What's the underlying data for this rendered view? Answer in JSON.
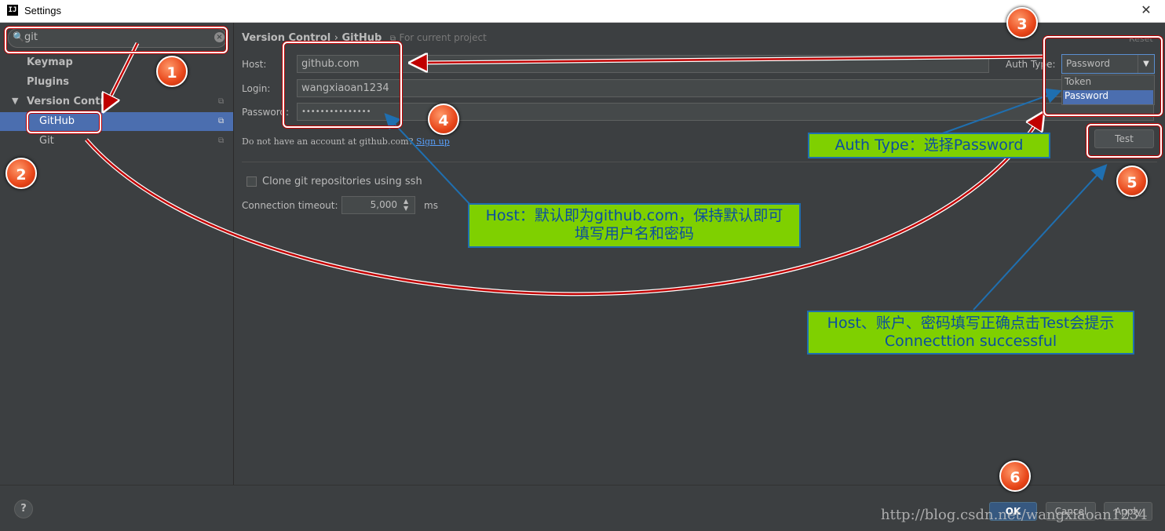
{
  "window": {
    "title": "Settings",
    "app_icon": "IJ",
    "close_glyph": "✕"
  },
  "sidebar": {
    "search_value": "git",
    "items": [
      {
        "label": "Keymap"
      },
      {
        "label": "Plugins"
      },
      {
        "label": "Version Control"
      },
      {
        "label": "GitHub"
      },
      {
        "label": "Git"
      }
    ]
  },
  "header": {
    "breadcrumb_root": "Version Control",
    "breadcrumb_sep": "›",
    "breadcrumb_leaf": "GitHub",
    "scope_note": "For current project",
    "reset": "Reset"
  },
  "form": {
    "host_label": "Host:",
    "host_value": "github.com",
    "login_label": "Login:",
    "login_value": "wangxiaoan1234",
    "password_label": "Password:",
    "password_value": "•••••••••••••••",
    "auth_type_label": "Auth Type:",
    "auth_type_value": "Password",
    "auth_options": [
      "Token",
      "Password"
    ],
    "signup_text": "Do not have an account at github.com?",
    "signup_link": "Sign up",
    "test_button": "Test",
    "clone_ssh_label": "Clone git repositories using ssh",
    "timeout_label": "Connection timeout:",
    "timeout_value": "5,000",
    "timeout_unit": "ms"
  },
  "footer": {
    "help": "?",
    "ok": "OK",
    "cancel": "Cancel",
    "apply": "Apply"
  },
  "annotations": {
    "badges": [
      "1",
      "2",
      "3",
      "4",
      "5",
      "6"
    ],
    "callout_auth": "Auth Type：选择Password",
    "callout_host_line1": "Host：默认即为github.com，保持默认即可",
    "callout_host_line2": "填写用户名和密码",
    "callout_test_line1": "Host、账户、密码填写正确点击Test会提示",
    "callout_test_line2": "Connecttion successful"
  },
  "watermark": "http://blog.csdn.net/wangxiaoan1234",
  "colors": {
    "selection": "#4b6eaf",
    "background": "#3c3f41",
    "callout_fill": "#7fd000",
    "callout_border": "#1f6fb0",
    "annotation_red": "#c00000"
  }
}
